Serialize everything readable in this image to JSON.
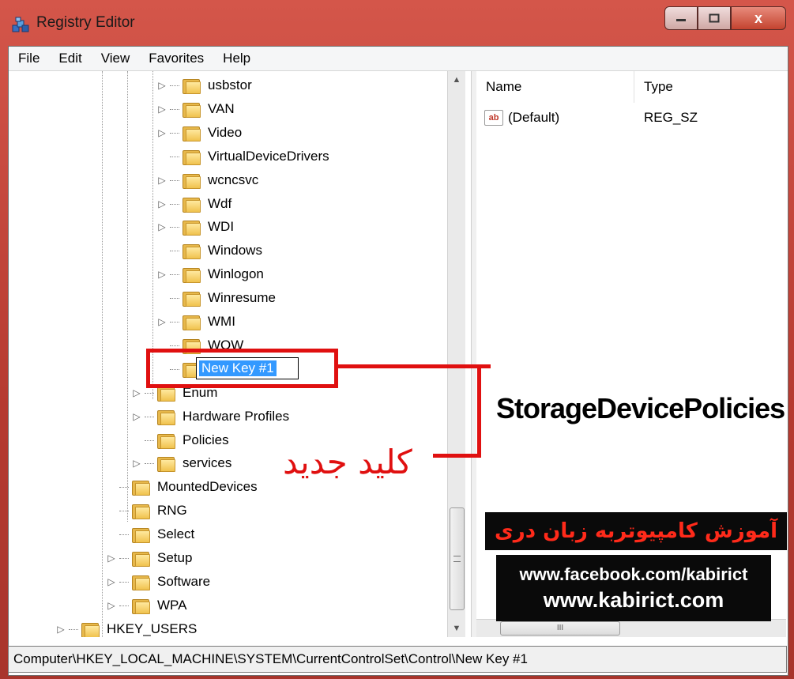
{
  "window": {
    "title": "Registry Editor",
    "close_glyph": "x"
  },
  "menu": [
    "File",
    "Edit",
    "View",
    "Favorites",
    "Help"
  ],
  "tree": {
    "items": [
      {
        "label": "usbstor",
        "expander": "▷"
      },
      {
        "label": "VAN",
        "expander": "▷"
      },
      {
        "label": "Video",
        "expander": "▷"
      },
      {
        "label": "VirtualDeviceDrivers",
        "expander": ""
      },
      {
        "label": "wcncsvc",
        "expander": "▷"
      },
      {
        "label": "Wdf",
        "expander": "▷"
      },
      {
        "label": "WDI",
        "expander": "▷"
      },
      {
        "label": "Windows",
        "expander": ""
      },
      {
        "label": "Winlogon",
        "expander": "▷"
      },
      {
        "label": "Winresume",
        "expander": ""
      },
      {
        "label": "WMI",
        "expander": "▷"
      },
      {
        "label": "WOW",
        "expander": ""
      }
    ],
    "editing_label": "New Key #1",
    "lower_items": [
      {
        "label": "Enum",
        "expander": "▷"
      },
      {
        "label": "Hardware Profiles",
        "expander": "▷"
      },
      {
        "label": "Policies",
        "expander": ""
      },
      {
        "label": "services",
        "expander": "▷"
      }
    ],
    "system_items": [
      {
        "label": "MountedDevices",
        "expander": ""
      },
      {
        "label": "RNG",
        "expander": ""
      },
      {
        "label": "Select",
        "expander": ""
      },
      {
        "label": "Setup",
        "expander": "▷"
      },
      {
        "label": "Software",
        "expander": "▷"
      },
      {
        "label": "WPA",
        "expander": "▷"
      }
    ],
    "root_item": {
      "label": "HKEY_USERS",
      "expander": "▷"
    }
  },
  "list": {
    "columns": [
      "Name",
      "Type"
    ],
    "rows": [
      {
        "name": "(Default)",
        "type": "REG_SZ",
        "icon": "ab"
      }
    ],
    "hscroll_grip": "III"
  },
  "annotations": {
    "key_name": "StorageDevicePolicies",
    "new_key_label": "کلید جدید",
    "banner_title": "آموزش کامپیوتربه زبان دری",
    "banner_url1": "www.facebook.com/kabirict",
    "banner_url2": "www.kabirict.com",
    "highlight_color": "#e01010"
  },
  "status": {
    "path": "Computer\\HKEY_LOCAL_MACHINE\\SYSTEM\\CurrentControlSet\\Control\\New Key #1"
  }
}
